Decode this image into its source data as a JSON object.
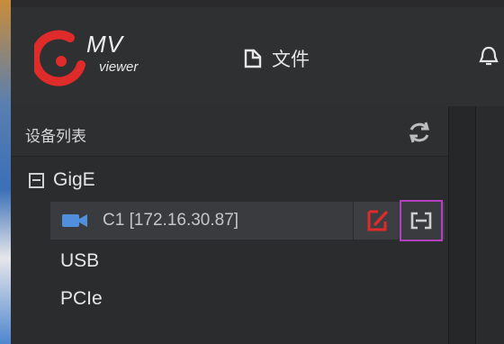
{
  "app": {
    "logo_title": "MV",
    "logo_subtitle": "viewer",
    "brand_color": "#e02b2b"
  },
  "menu": {
    "file_label": "文件",
    "file_icon": "file-icon",
    "alert_icon": "bell-icon"
  },
  "device_panel": {
    "title": "设备列表",
    "refresh_icon": "refresh-icon",
    "groups": [
      {
        "label": "GigE",
        "expanded": true,
        "devices": [
          {
            "label": "C1 [172.16.30.87]",
            "icon": "camera-icon",
            "edit_icon": "edit-icon",
            "connect_icon": "connect-icon"
          }
        ]
      },
      {
        "label": "USB"
      },
      {
        "label": "PCIe"
      }
    ]
  }
}
